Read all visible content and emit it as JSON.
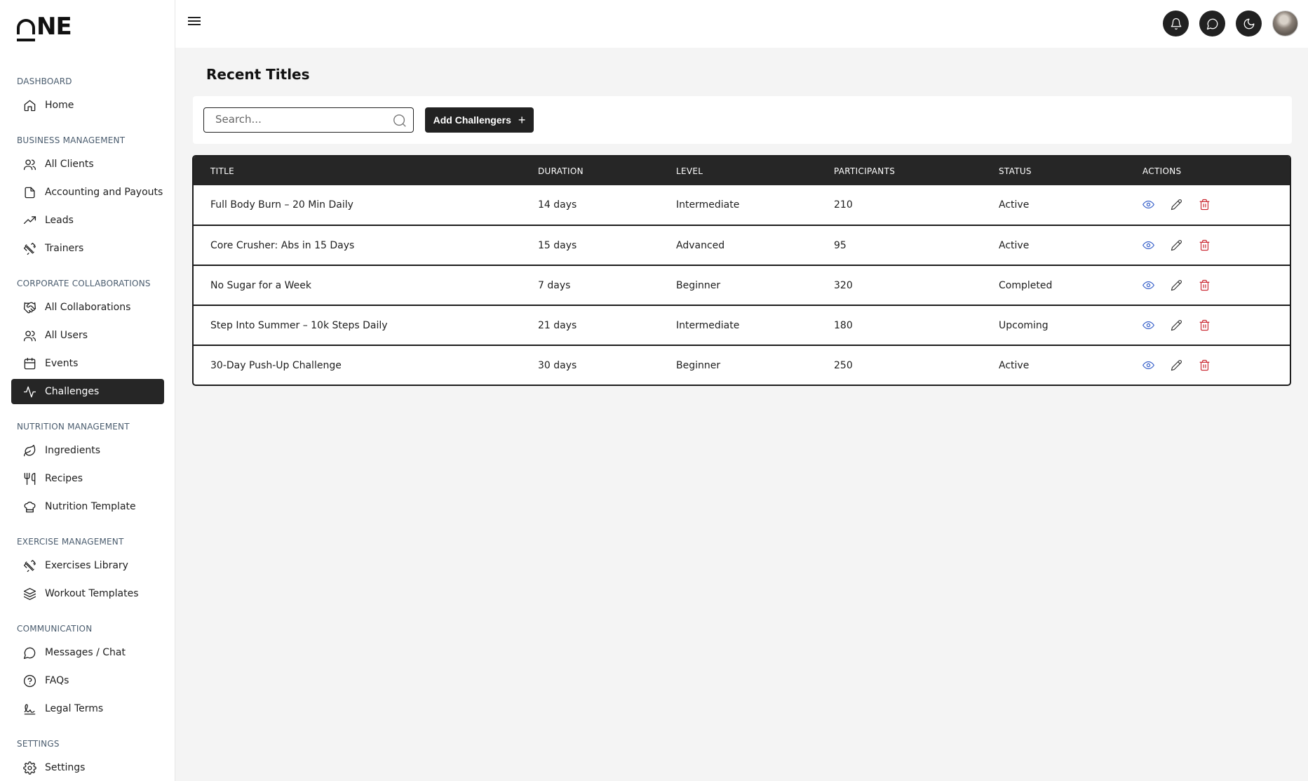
{
  "brand": {
    "logo_text": "NE"
  },
  "sidebar": {
    "sections": [
      {
        "title": "DASHBOARD",
        "items": [
          {
            "label": "Home",
            "icon": "home-icon"
          }
        ]
      },
      {
        "title": "BUSINESS MANAGEMENT",
        "items": [
          {
            "label": "All Clients",
            "icon": "users-icon"
          },
          {
            "label": "Accounting and Payouts",
            "icon": "file-icon"
          },
          {
            "label": "Leads",
            "icon": "trending-up-icon"
          },
          {
            "label": "Trainers",
            "icon": "dumbbell-icon"
          }
        ]
      },
      {
        "title": "CORPORATE COLLABORATIONS",
        "items": [
          {
            "label": "All Collaborations",
            "icon": "handshake-icon"
          },
          {
            "label": "All Users",
            "icon": "users-icon"
          },
          {
            "label": "Events",
            "icon": "calendar-icon"
          },
          {
            "label": "Challenges",
            "icon": "activity-icon",
            "active": true
          }
        ]
      },
      {
        "title": "NUTRITION MANAGEMENT",
        "items": [
          {
            "label": "Ingredients",
            "icon": "leaf-icon"
          },
          {
            "label": "Recipes",
            "icon": "utensils-icon"
          },
          {
            "label": "Nutrition Template",
            "icon": "chef-hat-icon"
          }
        ]
      },
      {
        "title": "EXERCISE MANAGEMENT",
        "items": [
          {
            "label": "Exercises Library",
            "icon": "dumbbell-icon"
          },
          {
            "label": "Workout Templates",
            "icon": "layers-icon"
          }
        ]
      },
      {
        "title": "COMMUNICATION",
        "items": [
          {
            "label": "Messages / Chat",
            "icon": "message-circle-icon"
          },
          {
            "label": "FAQs",
            "icon": "help-circle-icon"
          },
          {
            "label": "Legal Terms",
            "icon": "signature-icon"
          }
        ]
      },
      {
        "title": "SETTINGS",
        "items": [
          {
            "label": "Settings",
            "icon": "settings-icon"
          }
        ]
      }
    ]
  },
  "topbar": {
    "icons": [
      "bell-icon",
      "message-circle-icon",
      "moon-icon"
    ]
  },
  "main": {
    "title": "Recent Titles",
    "search": {
      "placeholder": "Search...",
      "value": ""
    },
    "add_button": {
      "label": "Add Challengers",
      "icon": "plus-icon"
    },
    "table": {
      "columns": [
        "TITLE",
        "DURATION",
        "LEVEL",
        "PARTICIPANTS",
        "STATUS",
        "ACTIONS"
      ],
      "rows": [
        {
          "title": "Full Body Burn – 20 Min Daily",
          "duration": "14 days",
          "level": "Intermediate",
          "participants": "210",
          "status": "Active"
        },
        {
          "title": "Core Crusher: Abs in 15 Days",
          "duration": "15 days",
          "level": "Advanced",
          "participants": "95",
          "status": "Active"
        },
        {
          "title": "No Sugar for a Week",
          "duration": "7 days",
          "level": "Beginner",
          "participants": "320",
          "status": "Completed"
        },
        {
          "title": "Step Into Summer – 10k Steps Daily",
          "duration": "21 days",
          "level": "Intermediate",
          "participants": "180",
          "status": "Upcoming"
        },
        {
          "title": "30-Day Push-Up Challenge",
          "duration": "30 days",
          "level": "Beginner",
          "participants": "250",
          "status": "Active"
        }
      ],
      "row_actions": [
        "eye-icon",
        "pencil-icon",
        "trash-icon"
      ]
    }
  },
  "colors": {
    "accent_dark": "#262626",
    "view_icon": "#2a56c6",
    "delete_icon": "#c8202a",
    "background": "#f4f4f4"
  }
}
